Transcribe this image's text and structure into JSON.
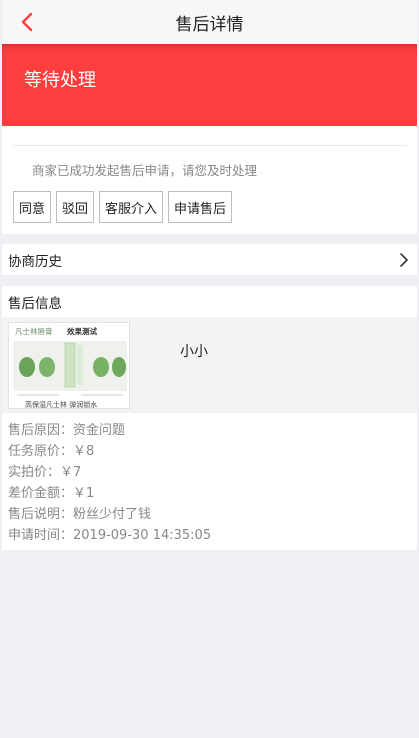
{
  "header": {
    "title": "售后详情",
    "back_icon": "chevron-left-icon",
    "accent": "#fd3e3e"
  },
  "status": {
    "text": "等待处理",
    "color": "#fd3e3e"
  },
  "notice": "商家已成功发起售后申请，请您及时处理",
  "actions": [
    {
      "label": "同意"
    },
    {
      "label": "驳回"
    },
    {
      "label": "客服介入"
    },
    {
      "label": "申请售后"
    }
  ],
  "history": {
    "label": "协商历史",
    "icon": "chevron-right-icon"
  },
  "info": {
    "title": "售后信息",
    "product": {
      "name": "小小",
      "image_title_left": "凡士林唇膏",
      "image_title_right": "效果测试",
      "image_footer": "高保湿凡士林  弹润锁水"
    },
    "rows": [
      {
        "key": "售后原因：",
        "value": "资金问题"
      },
      {
        "key": "任务原价：",
        "value": "￥8"
      },
      {
        "key": "实拍价：",
        "value": "￥7"
      },
      {
        "key": "差价金额：",
        "value": "￥1"
      },
      {
        "key": "售后说明：",
        "value": "粉丝少付了钱"
      },
      {
        "key": "申请时间：",
        "value": "2019-09-30 14:35:05"
      }
    ]
  }
}
